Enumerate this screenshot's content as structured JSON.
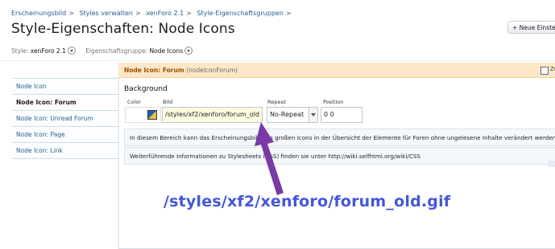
{
  "breadcrumb": [
    "Erscheinungsbild",
    "Styles verwalten",
    "xenForo 2.1",
    "Style-Eigenschaftsgruppen"
  ],
  "breadcrumb_separator": ">",
  "page_title": "Style-Eigenschaften: Node Icons",
  "header_button": "+ Neue Einstell",
  "filters": {
    "style_label": "Style:",
    "style_value": "xenForo 2.1",
    "group_label": "Eigenschaftsgruppe:",
    "group_value": "Node Icons"
  },
  "sidebar": {
    "items": [
      {
        "label": "Node Icon",
        "active": false
      },
      {
        "label": "Node Icon: Forum",
        "active": true
      },
      {
        "label": "Node Icon: Unread Forum",
        "active": false
      },
      {
        "label": "Node Icon: Page",
        "active": false
      },
      {
        "label": "Node Icon: Link",
        "active": false
      }
    ]
  },
  "panel": {
    "title": "Node Icon: Forum",
    "key": "(nodeIconForum)",
    "checkbox_label": "Zu",
    "section": "Background",
    "columns": {
      "color": "Color",
      "image": "Bild",
      "repeat": "Repeat",
      "position": "Position"
    },
    "values": {
      "image": "/styles/xf2/xenforo/forum_old",
      "repeat": "No-Repeat",
      "position": "0 0"
    },
    "info_1": "In diesem Bereich kann das Erscheinungsbild des großen Icons in der Übersicht der Elemente für Foren ohne ungelesene Inhalte verändert werden.",
    "info_2": "Weiterführende Informationen zu Stylesheets (CSS) finden sie unter http://wiki.selfhtml.org/wiki/CSS"
  },
  "annotation": {
    "text": "/styles/xf2/xenforo/forum_old.gif",
    "color": "#4456d8",
    "arrow_color": "#7a3aa5"
  }
}
